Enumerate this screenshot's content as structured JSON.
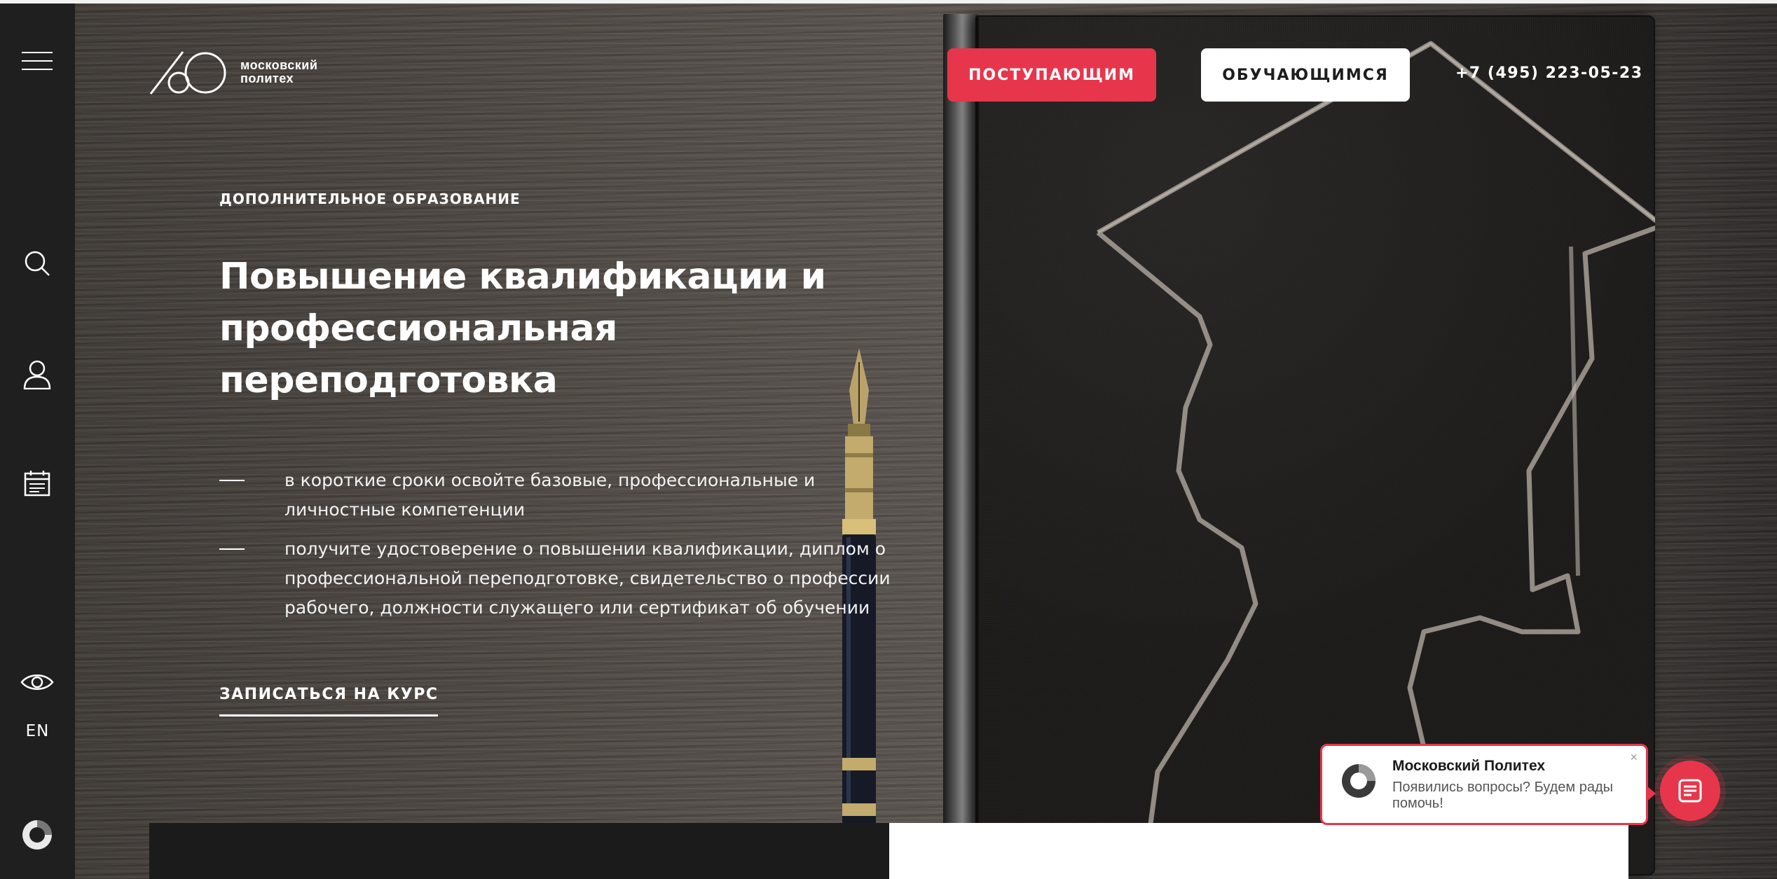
{
  "header": {
    "logo_line1": "московский",
    "logo_line2": "политех",
    "btn_applicants": "ПОСТУПАЮЩИМ",
    "btn_students": "ОБУЧАЮЩИМСЯ",
    "phone": "+7 (495) 223-05-23"
  },
  "sidebar": {
    "lang": "EN",
    "icons": [
      "menu-icon",
      "search-icon",
      "user-icon",
      "calendar-icon",
      "eye-icon",
      "chat-logo-icon"
    ]
  },
  "hero": {
    "eyebrow": "ДОПОЛНИТЕЛЬНОЕ ОБРАЗОВАНИЕ",
    "title_line1": "Повышение квалификации и",
    "title_line2": "профессиональная",
    "title_line3": "переподготовка",
    "bullets": [
      "в короткие сроки освойте базовые, профессиональные и личностные компетенции",
      "получите удостоверение о повышении квалификации, диплом о профессиональной переподготовке, свидетельство о профессии рабочего, должности служащего или сертификат об обучении"
    ],
    "cta": "ЗАПИСАТЬСЯ НА КУРС"
  },
  "chat": {
    "title": "Московский Политех",
    "message": "Появились вопросы? Будем рады помочь!",
    "close": "×"
  },
  "colors": {
    "accent": "#e7364c",
    "sidebar": "#1f1f1f",
    "white": "#ffffff"
  }
}
